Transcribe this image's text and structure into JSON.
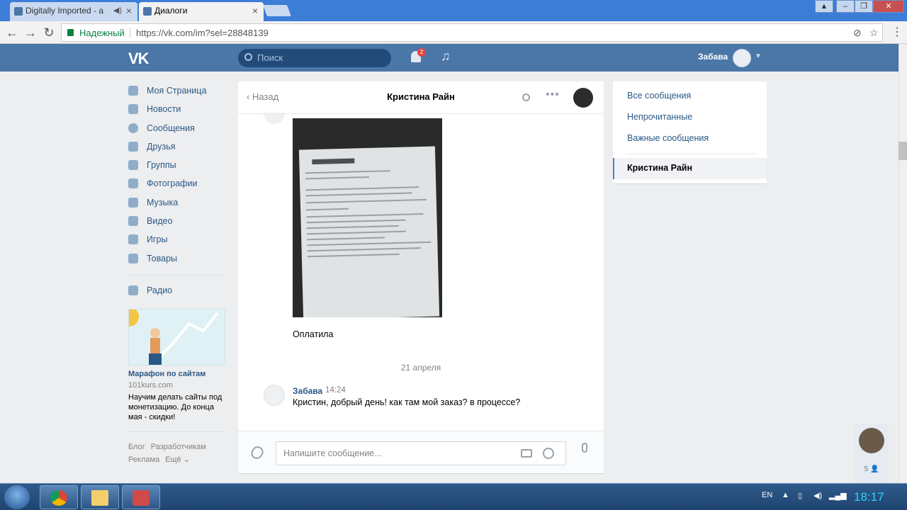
{
  "browser": {
    "tabs": [
      {
        "label": "Digitally Imported - a",
        "active": false
      },
      {
        "label": "Диалоги",
        "active": true
      }
    ],
    "secure_label": "Надежный",
    "url": "https://vk.com/im?sel=28848139"
  },
  "vk_header": {
    "logo": "VK",
    "search_placeholder": "Поиск",
    "notification_count": "2",
    "username": "Забава"
  },
  "left_nav": {
    "items": [
      {
        "label": "Моя Страница",
        "icon": "home-icon"
      },
      {
        "label": "Новости",
        "icon": "news-icon"
      },
      {
        "label": "Сообщения",
        "icon": "messages-icon"
      },
      {
        "label": "Друзья",
        "icon": "friends-icon"
      },
      {
        "label": "Группы",
        "icon": "groups-icon"
      },
      {
        "label": "Фотографии",
        "icon": "camera-icon"
      },
      {
        "label": "Музыка",
        "icon": "music-icon"
      },
      {
        "label": "Видео",
        "icon": "video-icon"
      },
      {
        "label": "Игры",
        "icon": "games-icon"
      },
      {
        "label": "Товары",
        "icon": "bag-icon"
      }
    ],
    "extra_item": {
      "label": "Радио",
      "icon": "apps-icon"
    }
  },
  "ad": {
    "title": "Марафон по сайтам",
    "domain": "101kurs.com",
    "text": "Научим делать сайты под монетизацию. До конца мая - скидки!"
  },
  "footer": {
    "links": [
      "Блог",
      "Разработчикам",
      "Реклама",
      "Ещё ⌄"
    ]
  },
  "chat": {
    "back_label": "Назад",
    "title": "Кристина Райн",
    "messages": [
      {
        "text": "Оплатила"
      },
      {
        "author": "Забава",
        "time": "14:24",
        "text": "Кристин, добрый день! как там мой заказ? в процессе?"
      }
    ],
    "date_separator": "21 апреля",
    "input_placeholder": "Напишите сообщение..."
  },
  "folders": {
    "items": [
      "Все сообщения",
      "Непрочитанные",
      "Важные сообщения"
    ],
    "active": "Кристина Райн"
  },
  "chatbar": {
    "count": "5"
  },
  "taskbar": {
    "lang": "EN",
    "clock": "18:17"
  }
}
